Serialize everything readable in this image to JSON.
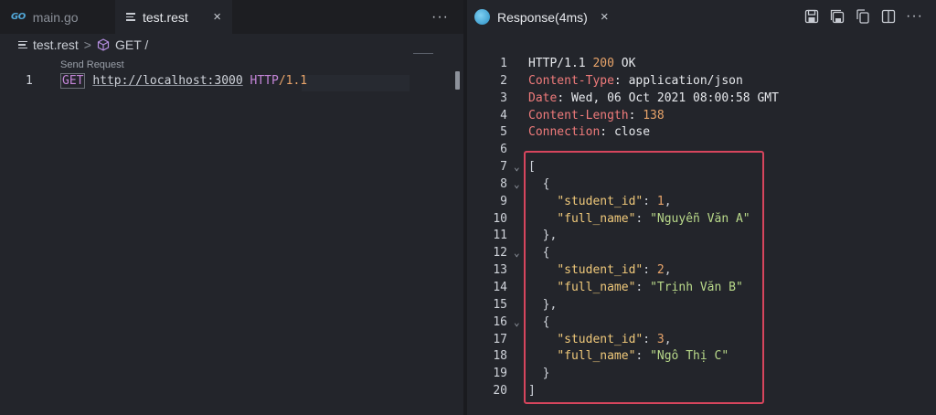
{
  "left_editor": {
    "tabs": [
      {
        "label": "main.go",
        "icon": "go-icon"
      },
      {
        "label": "test.rest",
        "icon": "lines-icon",
        "close": "×"
      }
    ],
    "more": "···",
    "breadcrumb": {
      "file": "test.rest",
      "separator": ">",
      "symbol": "GET /"
    },
    "codelens": "Send Request",
    "lines": [
      {
        "num": "1",
        "method": "GET",
        "url": "http://localhost:3000",
        "protocol": "HTTP",
        "version": "/1.1"
      }
    ]
  },
  "response_panel": {
    "tab": {
      "label": "Response(4ms)",
      "close": "×"
    },
    "more": "···",
    "line_numbers": [
      "1",
      "2",
      "3",
      "4",
      "5",
      "6",
      "7",
      "8",
      "9",
      "10",
      "11",
      "12",
      "13",
      "14",
      "15",
      "16",
      "17",
      "18",
      "19",
      "20"
    ],
    "status": {
      "http": "HTTP/1.1",
      "code": "200",
      "text": "OK"
    },
    "headers": [
      {
        "key": "Content-Type",
        "value": "application/json"
      },
      {
        "key": "Date",
        "value": "Wed, 06 Oct 2021 08:00:58 GMT"
      },
      {
        "key": "Content-Length",
        "value": "138"
      },
      {
        "key": "Connection",
        "value": "close"
      }
    ],
    "students": [
      {
        "id": "1",
        "name": "\"Nguyễn Văn A\""
      },
      {
        "id": "2",
        "name": "\"Trịnh Văn B\""
      },
      {
        "id": "3",
        "name": "\"Ngô Thị C\""
      }
    ],
    "json_keys": {
      "id": "\"student_id\"",
      "name": "\"full_name\""
    },
    "colors": {
      "highlight_box": "#d6455d",
      "header_key": "#f07b7b",
      "number": "#e8a46a",
      "json_key": "#f0c97a",
      "string": "#b9d98a"
    }
  }
}
